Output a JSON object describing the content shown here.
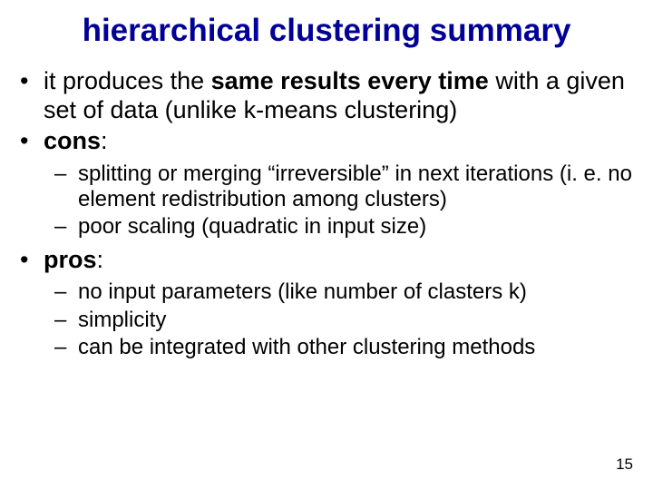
{
  "title": "hierarchical clustering summary",
  "bullets": {
    "b1_pre": "it produces the ",
    "b1_bold": "same results every time",
    "b1_post": " with a given set of data (unlike k-means clustering)",
    "cons_label": "cons",
    "cons_colon": ":",
    "cons_items": [
      "splitting or merging “irreversible” in next iterations (i. e. no element redistribution among clusters)",
      "poor scaling (quadratic in input size)"
    ],
    "pros_label": "pros",
    "pros_colon": ":",
    "pros_items": [
      "no input parameters (like number of clasters k)",
      "simplicity",
      "can be integrated with other clustering methods"
    ]
  },
  "page_number": "15"
}
